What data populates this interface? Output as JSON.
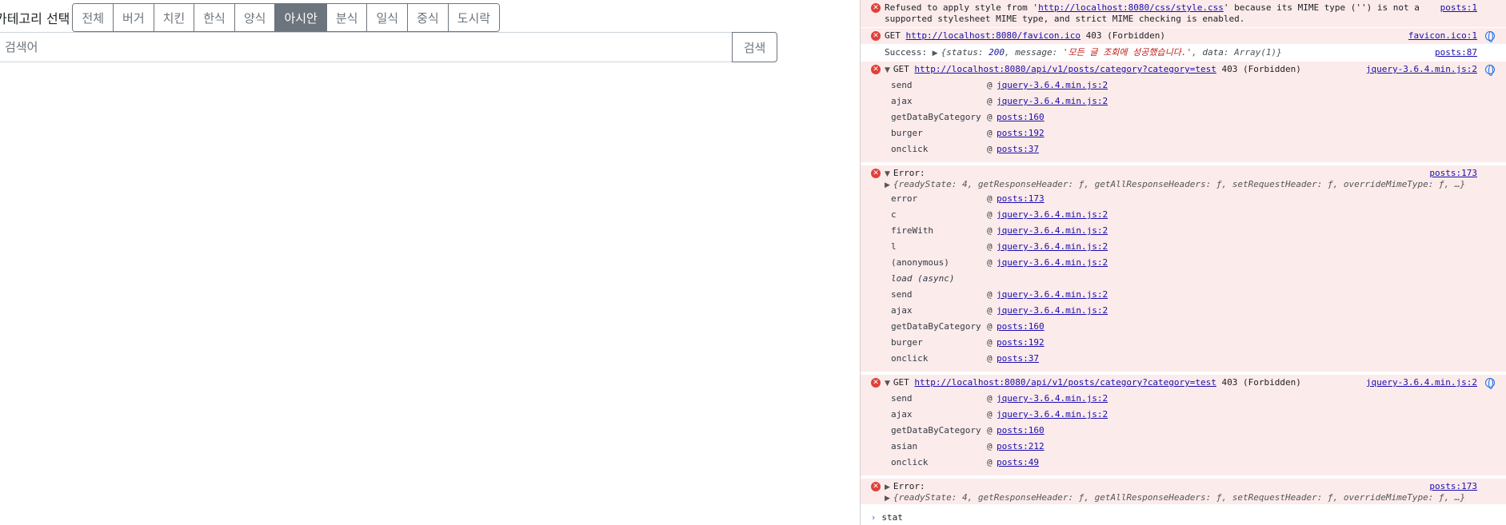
{
  "page": {
    "category_label": "카테고리 선택",
    "categories": [
      {
        "label": "전체",
        "active": false
      },
      {
        "label": "버거",
        "active": false
      },
      {
        "label": "치킨",
        "active": false
      },
      {
        "label": "한식",
        "active": false
      },
      {
        "label": "양식",
        "active": false
      },
      {
        "label": "아시안",
        "active": true
      },
      {
        "label": "분식",
        "active": false
      },
      {
        "label": "일식",
        "active": false
      },
      {
        "label": "중식",
        "active": false
      },
      {
        "label": "도시락",
        "active": false
      }
    ],
    "search_placeholder": "검색어",
    "search_button": "검색"
  },
  "console": {
    "m1": {
      "text_a": "Refused to apply style from '",
      "url": "http://localhost:8080/css/style.css",
      "text_b": "' because its MIME type ('') is not a supported stylesheet MIME type, and strict MIME checking is enabled.",
      "source": "posts:1"
    },
    "m2": {
      "method": "GET",
      "url": "http://localhost:8080/favicon.ico",
      "status": "403 (Forbidden)",
      "source": "favicon.ico:1"
    },
    "m3": {
      "label": "Success:",
      "k1": "status",
      "v1": "200",
      "k2": "message",
      "v2": "'모든 글 조회에 성공했습니다.'",
      "k3": "data",
      "v3": "Array(1)",
      "source": "posts:87"
    },
    "m4": {
      "method": "GET",
      "url": "http://localhost:8080/api/v1/posts/category?category=test",
      "status": "403 (Forbidden)",
      "source": "jquery-3.6.4.min.js:2",
      "stack": [
        {
          "fn": "send",
          "loc": "jquery-3.6.4.min.js:2"
        },
        {
          "fn": "ajax",
          "loc": "jquery-3.6.4.min.js:2"
        },
        {
          "fn": "getDataByCategory",
          "loc": "posts:160"
        },
        {
          "fn": "burger",
          "loc": "posts:192"
        },
        {
          "fn": "onclick",
          "loc": "posts:37"
        }
      ]
    },
    "m5": {
      "label": "Error:",
      "object": "{readyState: 4, getResponseHeader: ƒ, getAllResponseHeaders: ƒ, setRequestHeader: ƒ, overrideMimeType: ƒ, …}",
      "source": "posts:173",
      "stack": [
        {
          "fn": "error",
          "loc": "posts:173"
        },
        {
          "fn": "c",
          "loc": "jquery-3.6.4.min.js:2"
        },
        {
          "fn": "fireWith",
          "loc": "jquery-3.6.4.min.js:2"
        },
        {
          "fn": "l",
          "loc": "jquery-3.6.4.min.js:2"
        },
        {
          "fn": "(anonymous)",
          "loc": "jquery-3.6.4.min.js:2"
        }
      ],
      "async_label": "load (async)",
      "stack2": [
        {
          "fn": "send",
          "loc": "jquery-3.6.4.min.js:2"
        },
        {
          "fn": "ajax",
          "loc": "jquery-3.6.4.min.js:2"
        },
        {
          "fn": "getDataByCategory",
          "loc": "posts:160"
        },
        {
          "fn": "burger",
          "loc": "posts:192"
        },
        {
          "fn": "onclick",
          "loc": "posts:37"
        }
      ]
    },
    "m6": {
      "method": "GET",
      "url": "http://localhost:8080/api/v1/posts/category?category=test",
      "status": "403 (Forbidden)",
      "source": "jquery-3.6.4.min.js:2",
      "stack": [
        {
          "fn": "send",
          "loc": "jquery-3.6.4.min.js:2"
        },
        {
          "fn": "ajax",
          "loc": "jquery-3.6.4.min.js:2"
        },
        {
          "fn": "getDataByCategory",
          "loc": "posts:160"
        },
        {
          "fn": "asian",
          "loc": "posts:212"
        },
        {
          "fn": "onclick",
          "loc": "posts:49"
        }
      ]
    },
    "m7": {
      "label": "Error:",
      "object": "{readyState: 4, getResponseHeader: ƒ, getAllResponseHeaders: ƒ, setRequestHeader: ƒ, overrideMimeType: ƒ, …}",
      "source": "posts:173"
    },
    "prompt": "stat"
  }
}
